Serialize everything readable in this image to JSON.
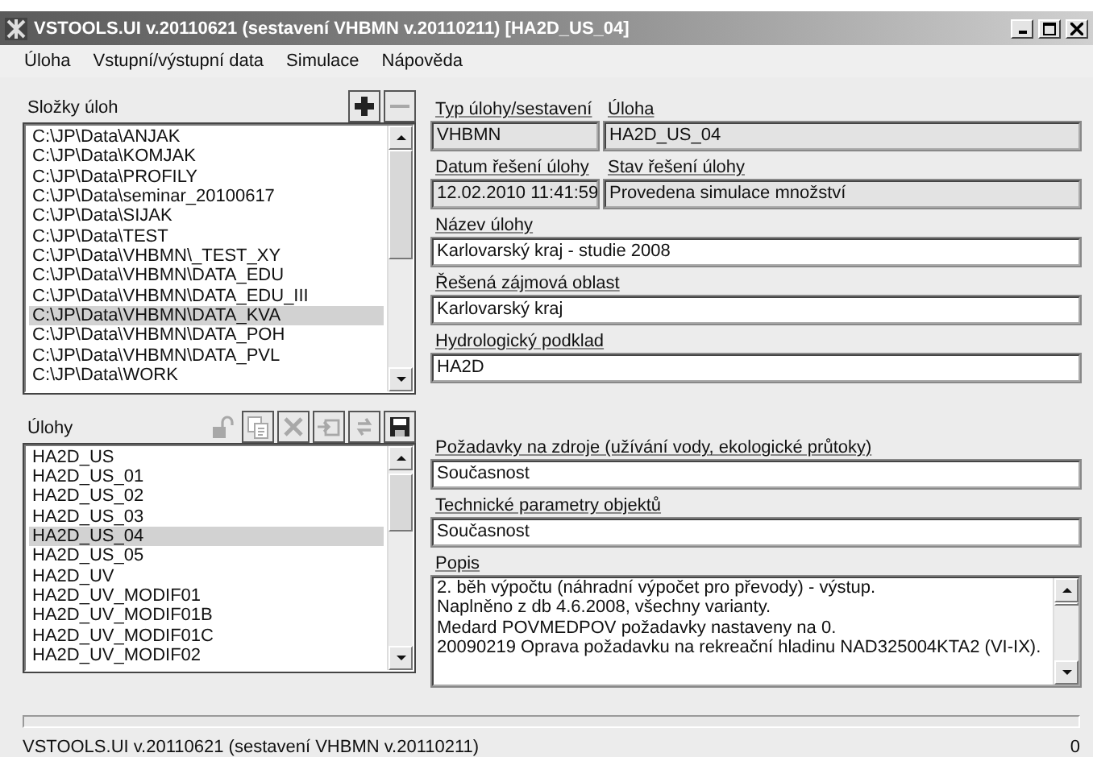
{
  "window": {
    "title": "VSTOOLS.UI v.20110621 (sestavení VHBMN v.20110211) [HA2D_US_04]"
  },
  "menu": [
    {
      "label": "Úloha"
    },
    {
      "label": "Vstupní/výstupní data"
    },
    {
      "label": "Simulace"
    },
    {
      "label": "Nápověda"
    }
  ],
  "folders": {
    "label": "Složky úloh",
    "tools": [
      {
        "kind": "add",
        "disabled": false
      },
      {
        "kind": "remove",
        "disabled": true
      }
    ],
    "items": [
      {
        "text": "C:\\JP\\Data\\ANJAK",
        "selected": false
      },
      {
        "text": "C:\\JP\\Data\\KOMJAK",
        "selected": false
      },
      {
        "text": "C:\\JP\\Data\\PROFILY",
        "selected": false
      },
      {
        "text": "C:\\JP\\Data\\seminar_20100617",
        "selected": false
      },
      {
        "text": "C:\\JP\\Data\\SIJAK",
        "selected": false
      },
      {
        "text": "C:\\JP\\Data\\TEST",
        "selected": false
      },
      {
        "text": "C:\\JP\\Data\\VHBMN\\_TEST_XY",
        "selected": false
      },
      {
        "text": "C:\\JP\\Data\\VHBMN\\DATA_EDU",
        "selected": false
      },
      {
        "text": "C:\\JP\\Data\\VHBMN\\DATA_EDU_III",
        "selected": false
      },
      {
        "text": "C:\\JP\\Data\\VHBMN\\DATA_KVA",
        "selected": true
      },
      {
        "text": "C:\\JP\\Data\\VHBMN\\DATA_POH",
        "selected": false
      },
      {
        "text": "C:\\JP\\Data\\VHBMN\\DATA_PVL",
        "selected": false
      },
      {
        "text": "C:\\JP\\Data\\WORK",
        "selected": false
      }
    ]
  },
  "tasks": {
    "label": "Úlohy",
    "tools": [
      {
        "kind": "lock",
        "disabled": true
      },
      {
        "kind": "copy",
        "disabled": true
      },
      {
        "kind": "delete",
        "disabled": true
      },
      {
        "kind": "import",
        "disabled": true
      },
      {
        "kind": "refresh",
        "disabled": true
      },
      {
        "kind": "save",
        "disabled": false
      }
    ],
    "items": [
      {
        "text": "HA2D_US",
        "selected": false
      },
      {
        "text": "HA2D_US_01",
        "selected": false
      },
      {
        "text": "HA2D_US_02",
        "selected": false
      },
      {
        "text": "HA2D_US_03",
        "selected": false
      },
      {
        "text": "HA2D_US_04",
        "selected": true
      },
      {
        "text": "HA2D_US_05",
        "selected": false
      },
      {
        "text": "HA2D_UV",
        "selected": false
      },
      {
        "text": "HA2D_UV_MODIF01",
        "selected": false
      },
      {
        "text": "HA2D_UV_MODIF01B",
        "selected": false
      },
      {
        "text": "HA2D_UV_MODIF01C",
        "selected": false
      },
      {
        "text": "HA2D_UV_MODIF02",
        "selected": false
      }
    ]
  },
  "form": {
    "rows": [
      [
        {
          "label": "Typ úlohy/sestavení",
          "value": "VHBMN",
          "readonly": true
        },
        {
          "label": "Úloha",
          "value": "HA2D_US_04",
          "readonly": true
        }
      ],
      [
        {
          "label": "Datum řešení úlohy",
          "value": "12.02.2010 11:41:59",
          "readonly": true
        },
        {
          "label": "Stav řešení úlohy",
          "value": "Provedena simulace množství",
          "readonly": true
        }
      ],
      [
        {
          "label": "Název úlohy",
          "value": "Karlovarský kraj - studie 2008",
          "readonly": false
        }
      ],
      [
        {
          "label": "Řešená zájmová oblast",
          "value": "Karlovarský kraj",
          "readonly": false
        }
      ],
      [
        {
          "label": "Hydrologický podklad",
          "value": "HA2D",
          "readonly": false
        }
      ],
      [
        {
          "label": "Požadavky na zdroje (užívání vody, ekologické průtoky)",
          "value": "Současnost",
          "readonly": false
        }
      ],
      [
        {
          "label": "Technické parametry objektů",
          "value": "Současnost",
          "readonly": false
        }
      ],
      [
        {
          "label": "Popis",
          "kind": "memo",
          "value": "2. běh výpočtu (náhradní výpočet pro převody) - výstup.\nNaplněno z db 4.6.2008, všechny varianty.\nMedard POVMEDPOV požadavky nastaveny na 0.\n20090219 Oprava požadavku na rekreační hladinu NAD325004KTA2 (VI-IX).",
          "readonly": false
        }
      ]
    ]
  },
  "progress": {
    "level": 0
  },
  "status_bar": {
    "text": "VSTOOLS.UI v.20110621 (sestavení VHBMN v.20110211)",
    "count": "0"
  }
}
